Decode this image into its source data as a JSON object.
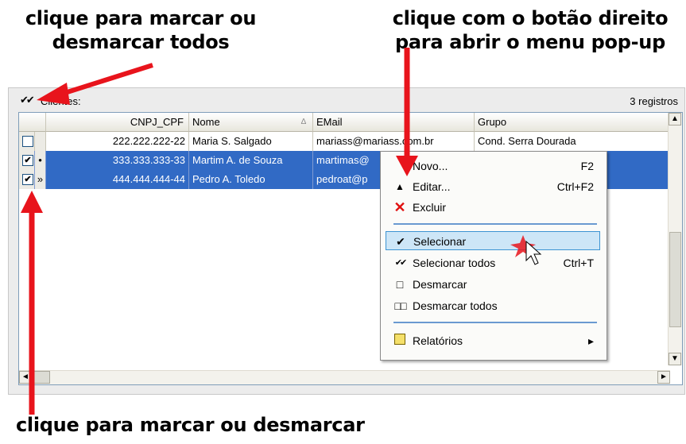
{
  "annotations": {
    "top_left": "clique para marcar ou desmarcar todos",
    "top_right": "clique com o botão direito para abrir o menu pop-up",
    "bottom": "clique para marcar ou desmarcar"
  },
  "panel": {
    "check_all_glyph": "✔✔",
    "label": "Clientes:",
    "record_count": "3 registros"
  },
  "table": {
    "columns": [
      "CNPJ_CPF",
      "Nome",
      "EMail",
      "Grupo"
    ],
    "sort_glyph": "∆",
    "rows": [
      {
        "checked": "",
        "indicator": "",
        "cnpj": "222.222.222-22",
        "nome": "Maria S. Salgado",
        "email": "mariass@mariass.com.br",
        "grupo": "Cond. Serra Dourada",
        "selected": false
      },
      {
        "checked": "✔",
        "indicator": "•",
        "cnpj": "333.333.333-33",
        "nome": "Martim A. de Souza",
        "email": "martimas@",
        "grupo": "",
        "selected": true
      },
      {
        "checked": "✔",
        "indicator": "»",
        "cnpj": "444.444.444-44",
        "nome": "Pedro A. Toledo",
        "email": "pedroat@p",
        "grupo": "",
        "selected": true
      }
    ]
  },
  "scroll": {
    "up": "▲",
    "down": "▼",
    "left": "◄",
    "right": "►"
  },
  "menu": {
    "items": [
      {
        "icon": "",
        "label": "Novo...",
        "shortcut": "F2"
      },
      {
        "icon": "▲",
        "label": "Editar...",
        "shortcut": "Ctrl+F2"
      },
      {
        "icon": "✕",
        "label": "Excluir",
        "shortcut": ""
      },
      {
        "icon": "✔",
        "label": "Selecionar",
        "shortcut": ""
      },
      {
        "icon": "✔✔",
        "label": "Selecionar todos",
        "shortcut": "Ctrl+T"
      },
      {
        "icon": "□",
        "label": "Desmarcar",
        "shortcut": ""
      },
      {
        "icon": "□□",
        "label": "Desmarcar todos",
        "shortcut": ""
      },
      {
        "icon": "",
        "label": "Relatórios",
        "shortcut": "▸"
      }
    ]
  },
  "colors": {
    "selection": "#316ac5",
    "arrow": "#e8141c",
    "menu_highlight": "#cde6f7"
  }
}
